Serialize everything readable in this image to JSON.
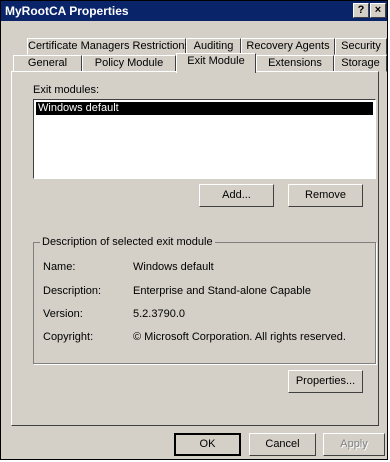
{
  "window": {
    "title": "MyRootCA Properties",
    "help_btn": "?",
    "close_btn": "×"
  },
  "tabs_row1": [
    {
      "label": "Certificate Managers Restrictions"
    },
    {
      "label": "Auditing"
    },
    {
      "label": "Recovery Agents"
    },
    {
      "label": "Security"
    }
  ],
  "tabs_row2": [
    {
      "label": "General"
    },
    {
      "label": "Policy Module"
    },
    {
      "label": "Exit Module"
    },
    {
      "label": "Extensions"
    },
    {
      "label": "Storage"
    }
  ],
  "exit_modules": {
    "label": "Exit modules:",
    "items": [
      "Windows default"
    ]
  },
  "buttons": {
    "add": "Add...",
    "remove": "Remove",
    "properties": "Properties...",
    "ok": "OK",
    "cancel": "Cancel",
    "apply": "Apply"
  },
  "description": {
    "legend": "Description of selected exit module",
    "name_label": "Name:",
    "name_value": "Windows default",
    "description_label": "Description:",
    "description_value": "Enterprise and Stand-alone Capable",
    "version_label": "Version:",
    "version_value": "5.2.3790.0",
    "copyright_label": "Copyright:",
    "copyright_value": "© Microsoft Corporation. All rights reserved."
  }
}
